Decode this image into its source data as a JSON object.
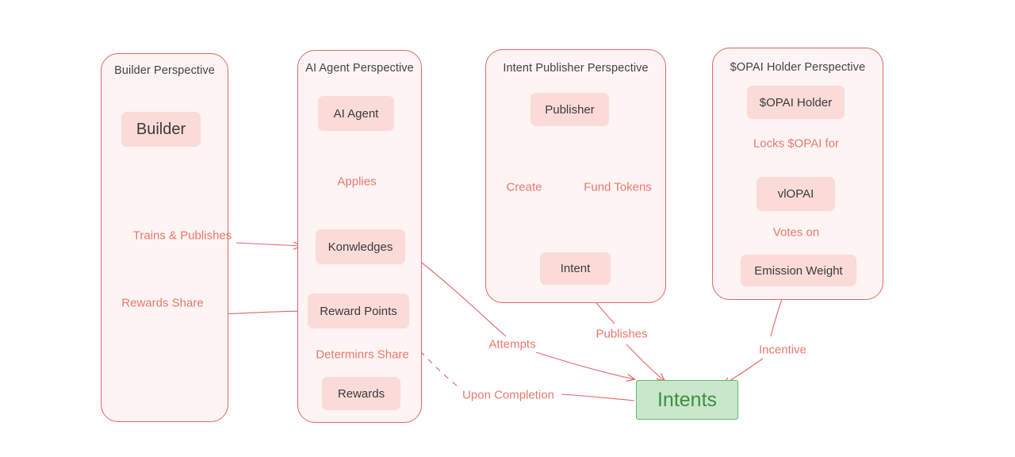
{
  "diagram": {
    "type": "flowchart",
    "background": "#ffffff",
    "colors": {
      "subgraph_border": "#e0676a",
      "subgraph_fill": "#fdf4f3",
      "node_fill": "#fadbd8",
      "node_text": "#3b3b3b",
      "edge_stroke": "#e0676a",
      "edge_label_text": "#e8796f",
      "intents_fill": "#c9e7ca",
      "intents_border": "#63b866",
      "intents_text": "#3e8e41",
      "title_text": "#444444"
    },
    "subgraphs": [
      {
        "id": "builder",
        "title": "Builder Perspective",
        "nodes": [
          {
            "id": "builder-node",
            "label": "Builder"
          }
        ]
      },
      {
        "id": "ai-agent",
        "title": "AI Agent Perspective",
        "nodes": [
          {
            "id": "ai-agent-node",
            "label": "AI Agent"
          },
          {
            "id": "knowledges-node",
            "label": "Konwledges"
          },
          {
            "id": "reward-points-node",
            "label": "Reward Points"
          },
          {
            "id": "rewards-node",
            "label": "Rewards"
          }
        ]
      },
      {
        "id": "intent-publisher",
        "title": "Intent Publisher Perspective",
        "nodes": [
          {
            "id": "publisher-node",
            "label": "Publisher"
          },
          {
            "id": "intent-node",
            "label": "Intent"
          }
        ]
      },
      {
        "id": "opai-holder",
        "title": "$OPAI Holder Perspective",
        "nodes": [
          {
            "id": "opai-holder-node",
            "label": "$OPAI Holder"
          },
          {
            "id": "viopai-node",
            "label": "vlOPAI"
          },
          {
            "id": "emission-weight-node",
            "label": "Emission Weight"
          }
        ]
      }
    ],
    "standalone_nodes": [
      {
        "id": "intents-node",
        "label": "Intents"
      }
    ],
    "edges": [
      {
        "id": "e-applies",
        "from": "ai-agent-node",
        "to": "knowledges-node",
        "label": "Applies"
      },
      {
        "id": "e-determines-share",
        "from": "reward-points-node",
        "to": "rewards-node",
        "label": "Determinrs Share"
      },
      {
        "id": "e-trains-publishes",
        "from": "builder-node",
        "to": "knowledges-node",
        "label": "Trains & Publishes"
      },
      {
        "id": "e-rewards-share",
        "from": "reward-points-node",
        "to": "builder-node",
        "label": "Rewards Share"
      },
      {
        "id": "e-create",
        "from": "publisher-node",
        "to": "intent-node",
        "label": "Create"
      },
      {
        "id": "e-fund-tokens",
        "from": "publisher-node",
        "to": "intent-node",
        "label": "Fund Tokens"
      },
      {
        "id": "e-locks-opai-for",
        "from": "opai-holder-node",
        "to": "viopai-node",
        "label": "Locks $OPAI for"
      },
      {
        "id": "e-votes-on",
        "from": "viopai-node",
        "to": "emission-weight-node",
        "label": "Votes on"
      },
      {
        "id": "e-attempts",
        "from": "knowledges-node",
        "to": "intents-node",
        "label": "Attempts"
      },
      {
        "id": "e-upon-completion",
        "from": "intents-node",
        "to": "reward-points-node",
        "label": "Upon Completion"
      },
      {
        "id": "e-publishes",
        "from": "intent-node",
        "to": "intents-node",
        "label": "Publishes"
      },
      {
        "id": "e-incentive",
        "from": "emission-weight-node",
        "to": "intents-node",
        "label": "Incentive"
      }
    ]
  }
}
